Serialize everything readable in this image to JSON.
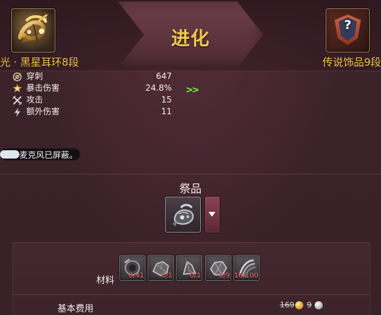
{
  "header": {
    "title": "进化",
    "source_item_name": "光 · 黑星耳环8段",
    "target_item_name": "传说饰品9段",
    "target_icon_text": "?"
  },
  "stats": [
    {
      "label": "穿刺",
      "value": "647",
      "icon": "piercing-icon"
    },
    {
      "label": "暴击伤害",
      "value": "24.8%",
      "icon": "critical-damage-icon"
    },
    {
      "label": "攻击",
      "value": "15",
      "icon": "attack-icon"
    },
    {
      "label": "额外伤害",
      "value": "11",
      "icon": "extra-damage-icon"
    }
  ],
  "comparison_arrows": ">>",
  "microphone_notice": "麦克风已屏蔽。",
  "sacrifice": {
    "label": "祭品",
    "dropdown_icon": "triangle-down-icon"
  },
  "materials": {
    "label": "材料",
    "items": [
      {
        "count": "0/41",
        "icon": "material-ring-icon"
      },
      {
        "count": "0/1",
        "icon": "material-ore-icon"
      },
      {
        "count": "0/1",
        "icon": "material-shard-icon"
      },
      {
        "count": "0/9",
        "icon": "material-crystal-icon"
      },
      {
        "count": "16/100",
        "icon": "material-claw-icon"
      }
    ]
  },
  "cost": {
    "label": "基本费用",
    "gold": "169",
    "silver": "9"
  },
  "colors": {
    "title_gold": "#f0c84b",
    "item_name_gold": "#f5c74d",
    "positive_green": "#69ff3d",
    "material_shortage_red": "#ff6b70",
    "panel_bg": "#3a2128",
    "dropdown_bg": "#8b4253"
  }
}
